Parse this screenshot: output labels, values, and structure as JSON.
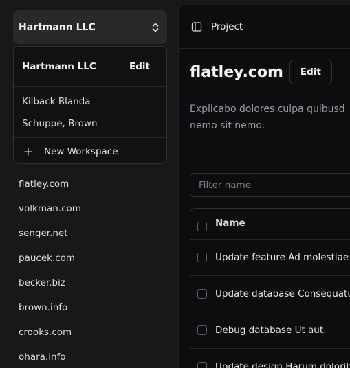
{
  "workspace_switcher": {
    "current": "Hartmann LLC",
    "icon": "chevron-up-down-icon"
  },
  "workspace_menu": {
    "current_name": "Hartmann LLC",
    "edit_label": "Edit",
    "items": [
      "Kilback-Blanda",
      "Schuppe, Brown"
    ],
    "new_workspace_label": "New Workspace"
  },
  "projects": [
    "flatley.com",
    "volkman.com",
    "senger.net",
    "paucek.com",
    "becker.biz",
    "brown.info",
    "crooks.com",
    "ohara.info"
  ],
  "topbar": {
    "breadcrumb": "Project",
    "icon": "sidebar-toggle-icon"
  },
  "project": {
    "title": "flatley.com",
    "edit_label": "Edit",
    "description_line1": "Explicabo dolores culpa quibusd",
    "description_line2": "nemo sit nemo."
  },
  "filter": {
    "placeholder": "Filter name"
  },
  "table": {
    "columns": [
      "Name"
    ],
    "rows": [
      "Update feature Ad molestiae do",
      "Update database Consequatur",
      "Debug database Ut aut.",
      "Update design Harum doloribu"
    ]
  }
}
